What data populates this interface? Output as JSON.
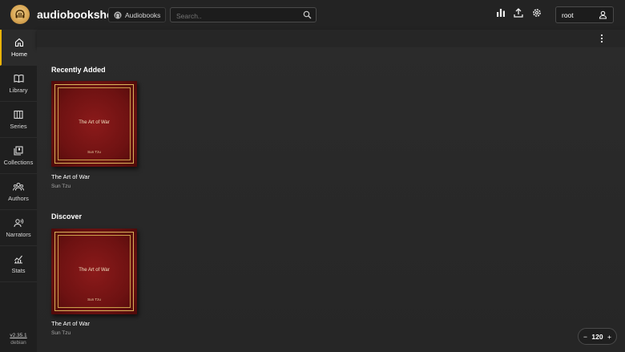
{
  "app": {
    "title": "audiobookshelf"
  },
  "library_select": {
    "label": "Audiobooks"
  },
  "search": {
    "placeholder": "Search.."
  },
  "user": {
    "name": "root"
  },
  "sidebar": {
    "items": [
      {
        "label": "Home",
        "icon": "home-icon",
        "active": true
      },
      {
        "label": "Library",
        "icon": "book-open-icon"
      },
      {
        "label": "Series",
        "icon": "columns-icon"
      },
      {
        "label": "Collections",
        "icon": "collections-icon"
      },
      {
        "label": "Authors",
        "icon": "authors-icon"
      },
      {
        "label": "Narrators",
        "icon": "narrator-icon"
      },
      {
        "label": "Stats",
        "icon": "stats-icon"
      }
    ],
    "version": "v2.35.1",
    "os": "debian"
  },
  "shelves": [
    {
      "title": "Recently Added",
      "book": {
        "title": "The Art of War",
        "author": "Sun Tzu",
        "cover_title": "The Art of War",
        "cover_author": "Sun Tzu"
      }
    },
    {
      "title": "Discover",
      "book": {
        "title": "The Art of War",
        "author": "Sun Tzu",
        "cover_title": "The Art of War",
        "cover_author": "Sun Tzu"
      }
    }
  ],
  "zoom": {
    "minus": "−",
    "value": "120",
    "plus": "+"
  },
  "colors": {
    "accent": "#eab308",
    "topbar": "#232323",
    "sidebar": "#1f1f1f",
    "cover_red": "#7a1515",
    "cover_gold": "#d9b35a"
  }
}
